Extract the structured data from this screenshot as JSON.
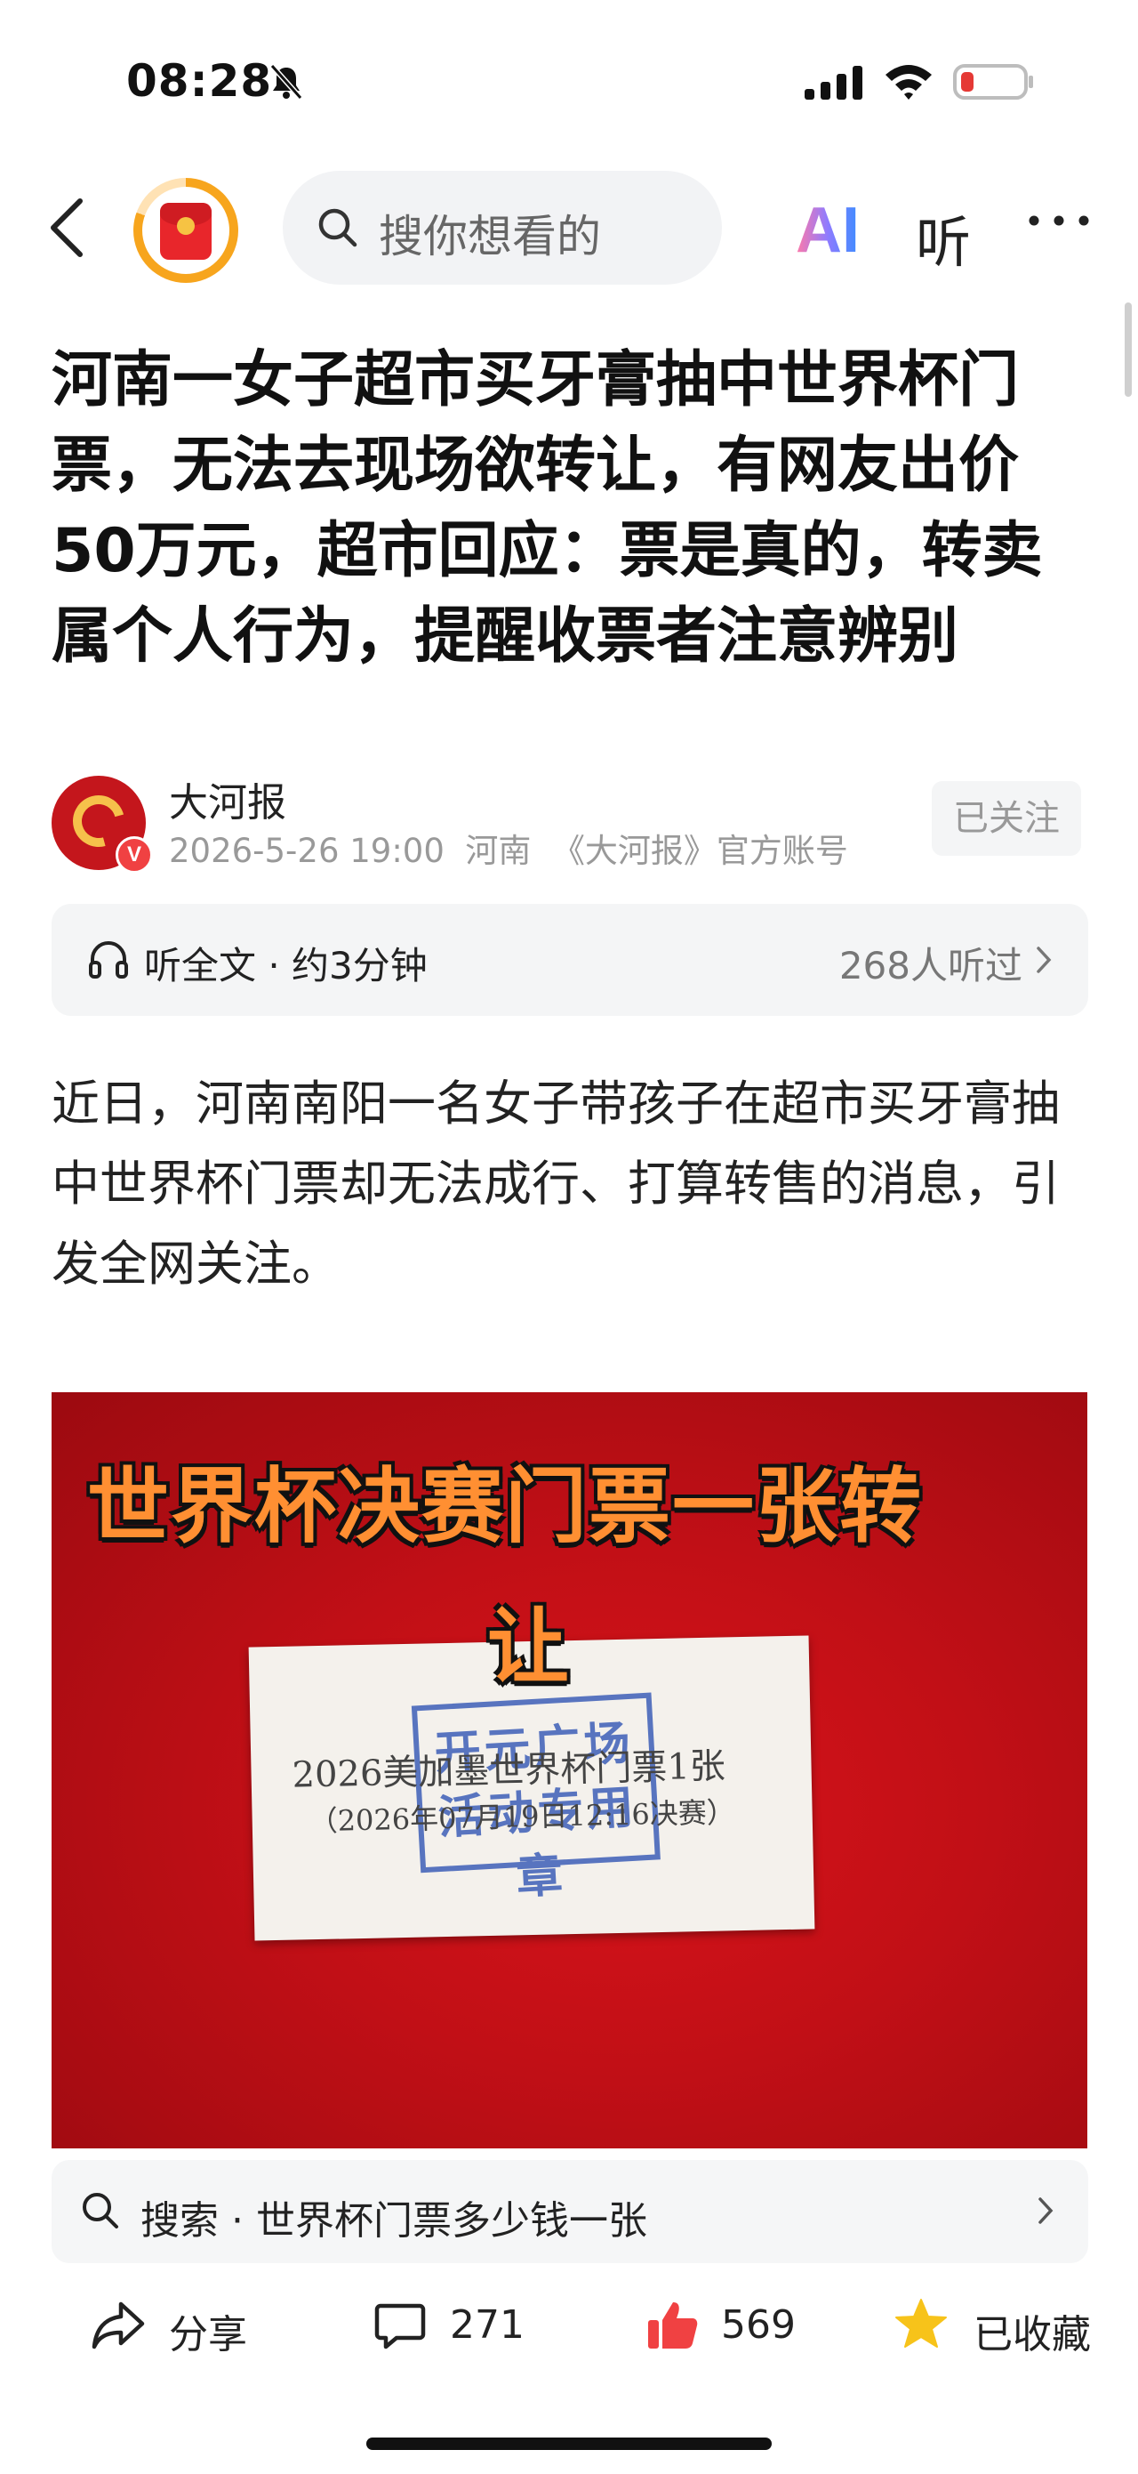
{
  "status_bar": {
    "time": "08:28"
  },
  "nav": {
    "search_placeholder": "搜你想看的",
    "ai_label": "AI",
    "listen_label": "听"
  },
  "article": {
    "title": "河南一女子超市买牙膏抽中世界杯门票，无法去现场欲转让，有网友出价50万元，超市回应：票是真的，转卖属个人行为，提醒收票者注意辨别",
    "author": {
      "name": "大河报",
      "date": "2026-5-26 19:00",
      "location": "河南",
      "account_type": "《大河报》官方账号",
      "follow_label": "已关注",
      "badge": "V"
    },
    "listen_bar": {
      "label": "听全文 · 约3分钟",
      "count": "268人听过"
    },
    "paragraph": "近日，河南南阳一名女子带孩子在超市买牙膏抽中世界杯门票却无法成行、打算转售的消息，引发全网关注。",
    "image": {
      "caption_line1": "世界杯决赛门票一张转",
      "caption_line2": "让",
      "paper_line1": "2026美加墨世界杯门票1张",
      "paper_line2": "（2026年07月19日12:16决赛）",
      "stamp_line1": "开元广场",
      "stamp_line2": "活动专用章"
    }
  },
  "search_suggestion": {
    "prefix": "搜索",
    "query": "世界杯门票多少钱一张",
    "text": "搜索 · 世界杯门票多少钱一张"
  },
  "bottom_bar": {
    "share": "分享",
    "comments": "271",
    "likes": "569",
    "favorite": "已收藏"
  },
  "colors": {
    "accent_red": "#f04142",
    "like_red": "#f04142",
    "star_yellow": "#f7c31a",
    "orange": "#f7a51d"
  }
}
